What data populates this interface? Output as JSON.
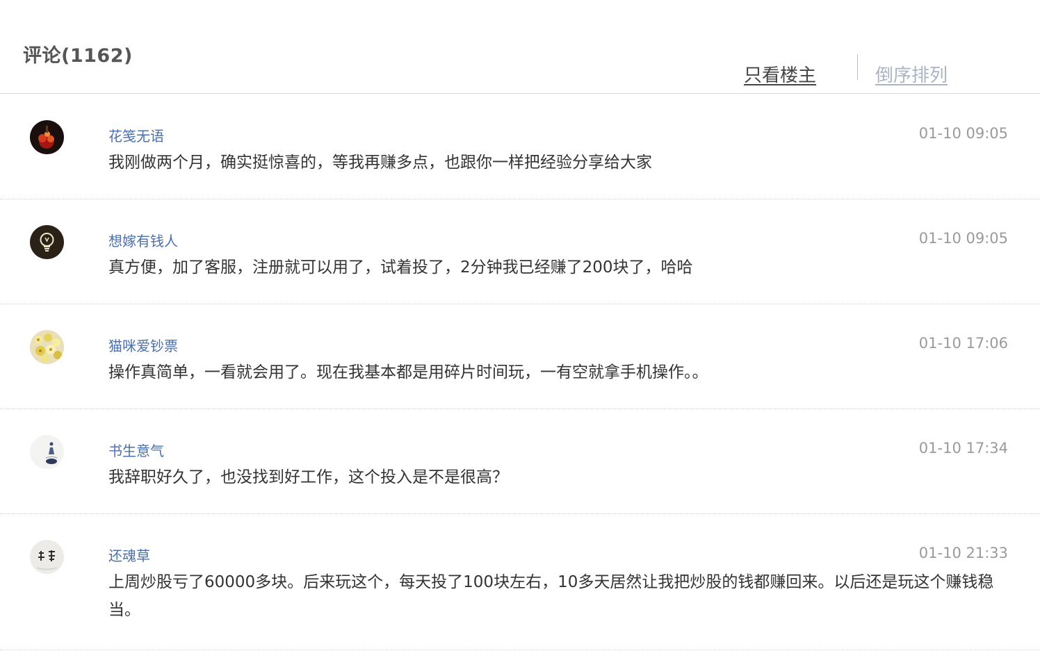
{
  "header": {
    "title": "评论",
    "count": "1162",
    "filter_label": "只看楼主",
    "sort_label": "倒序排列"
  },
  "comments": [
    {
      "author": "花笺无语",
      "time": "01-10 09:05",
      "text": "我刚做两个月，确实挺惊喜的，等我再赚多点，也跟你一样把经验分享给大家",
      "avatar": "dark-red-flower-avatar"
    },
    {
      "author": "想嫁有钱人",
      "time": "01-10 09:05",
      "text": "真方便，加了客服，注册就可以用了，试着投了，2分钟我已经赚了200块了，哈哈",
      "avatar": "lightbulb-avatar"
    },
    {
      "author": "猫咪爱钞票",
      "time": "01-10 17:06",
      "text": "操作真简单，一看就会用了。现在我基本都是用碎片时间玩，一有空就拿手机操作。。",
      "avatar": "yellow-flowers-avatar"
    },
    {
      "author": "书生意气",
      "time": "01-10 17:34",
      "text": "我辞职好久了，也没找到好工作，这个投入是不是很高？",
      "avatar": "ink-figure-avatar"
    },
    {
      "author": "还魂草",
      "time": "01-10 21:33",
      "text": "上周炒股亏了60000多块。后来玩这个，每天投了100块左右，10多天居然让我把炒股的钱都赚回来。以后还是玩这个赚钱稳当。",
      "avatar": "calligraphy-avatar"
    }
  ],
  "colors": {
    "author_link": "#4a6fae",
    "timestamp": "#9a9a9a",
    "sort_link": "#aab4c4"
  }
}
